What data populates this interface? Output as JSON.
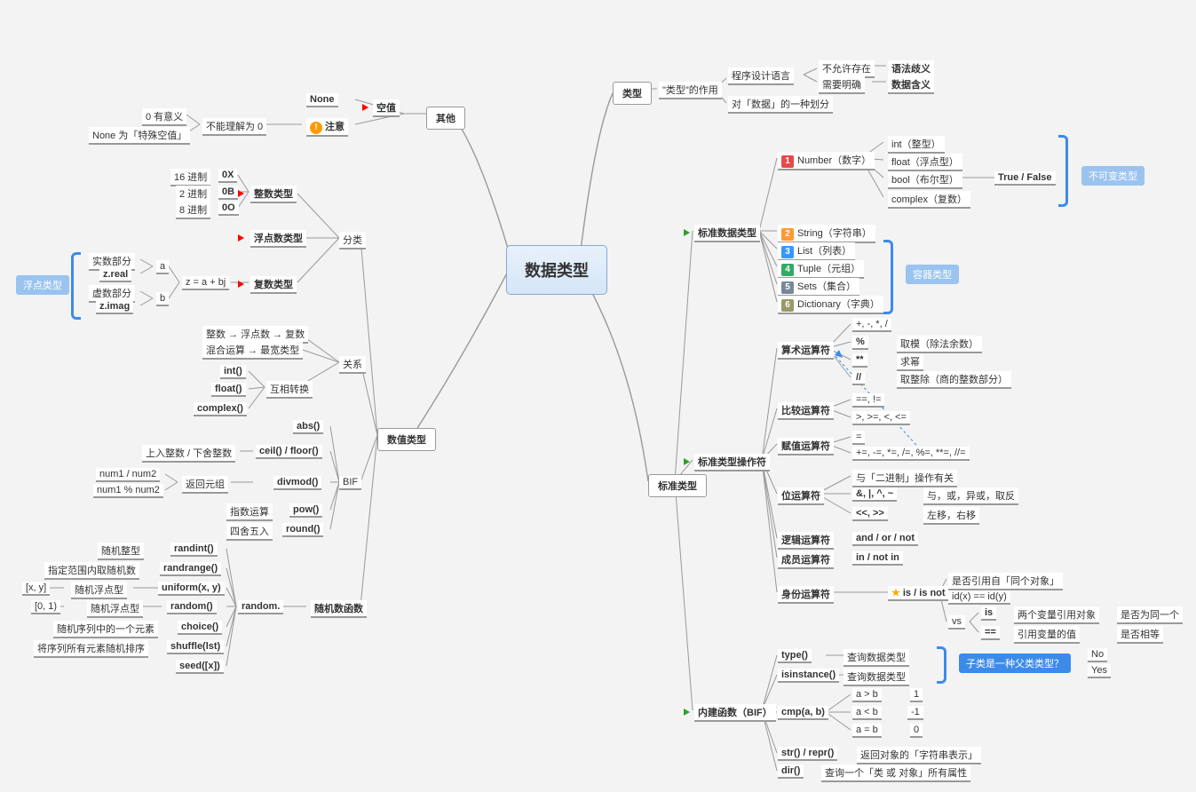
{
  "center": "数据类型",
  "leixing": {
    "title": "类型",
    "role": "\"类型\"的作用",
    "design": "程序设计语言",
    "notallow": "不允许存在",
    "syntax": "语法歧义",
    "need": "需要明确",
    "meaning": "数据含义",
    "classify": "对「数据」的一种划分"
  },
  "biaozhun": {
    "title": "标准类型",
    "stdlabel": "标准数据类型",
    "oplabel": "标准类型操作符",
    "biflabel": "内建函数（BIF）",
    "num": {
      "n": "1",
      "name": "Number（数字）",
      "int": "int（整型）",
      "float": "float（浮点型）",
      "bool": "bool（布尔型）",
      "booltf": "True / False",
      "complex": "complex（复数）"
    },
    "string": {
      "n": "2",
      "name": "String（字符串）"
    },
    "list": {
      "n": "3",
      "name": "List（列表）"
    },
    "tuple": {
      "n": "4",
      "name": "Tuple（元组）"
    },
    "sets": {
      "n": "5",
      "name": "Sets（集合）"
    },
    "dict": {
      "n": "6",
      "name": "Dictionary（字典）"
    },
    "immutable": "不可变类型",
    "container": "容器类型",
    "ops": {
      "arith": {
        "title": "算术运算符",
        "l1": "+, -, *, /",
        "l2": "%",
        "l2d": "取模（除法余数）",
        "l3": "**",
        "l3d": "求幂",
        "l4": "//",
        "l4d": "取整除（商的整数部分）"
      },
      "cmp": {
        "title": "比较运算符",
        "l1": "==, !=",
        "l2": ">, >=, <, <="
      },
      "assign": {
        "title": "赋值运算符",
        "l1": "=",
        "l2": "+=, -=, *=, /=, %=, **=, //="
      },
      "bit": {
        "title": "位运算符",
        "l1": "与「二进制」操作有关",
        "l2": "&, |, ^, ~",
        "l2d": "与，或，异或，取反",
        "l3": "<<, >>",
        "l3d": "左移，右移"
      },
      "logic": {
        "title": "逻辑运算符",
        "val": "and / or / not"
      },
      "member": {
        "title": "成员运算符",
        "val": "in / not in"
      },
      "identity": {
        "title": "身份运算符",
        "val": "is / is not",
        "d1": "是否引用自「同个对象」",
        "d2": "id(x) == id(y)",
        "vs": "vs",
        "is": "is",
        "isdesc": "两个变量引用对象",
        "isask": "是否为同一个",
        "eq": "==",
        "eqdesc": "引用变量的值",
        "eqask": "是否相等"
      }
    },
    "bif": {
      "type": "type()",
      "typed": "查询数据类型",
      "isinst": "isinstance()",
      "isinstd": "查询数据类型",
      "cmp": "cmp(a, b)",
      "c1": "a > b",
      "c1v": "1",
      "c2": "a < b",
      "c2v": "-1",
      "c3": "a = b",
      "c3v": "0",
      "str": "str() / repr()",
      "strd": "返回对象的「字符串表示」",
      "dir": "dir()",
      "dird": "查询一个「类 或 对象」所有属性",
      "callout": "子类是一种父类类型？",
      "no": "No",
      "yes": "Yes"
    }
  },
  "shuzhi": {
    "title": "数值类型",
    "fenlei": "分类",
    "ints": {
      "title": "整数类型",
      "b16": "16 进制",
      "b16v": "0X",
      "b2": "2 进制",
      "b2v": "0B",
      "b8": "8 进制",
      "b8v": "0O"
    },
    "floats": "浮点数类型",
    "complex": {
      "title": "复数类型",
      "eq": "z = a + bj",
      "a": "a",
      "b": "b",
      "real": "实数部分",
      "zreal": "z.real",
      "imag": "虚数部分",
      "zimag": "z.imag",
      "floattype": "浮点类型"
    },
    "guanxi": {
      "title": "关系",
      "l1": "整数 → 浮点数 → 复数",
      "l2": "混合运算 → 最宽类型",
      "convert": "互相转换",
      "int": "int()",
      "float": "float()",
      "complex": "complex()"
    },
    "bif": {
      "title": "BIF",
      "abs": "abs()",
      "ceil": "ceil() / floor()",
      "ceild": "上入整数 / 下舍整数",
      "divmod": "divmod()",
      "divmodd": "返回元组",
      "dn1": "num1 / num2",
      "dn2": "num1 % num2",
      "pow": "pow()",
      "powd": "指数运算",
      "round": "round()",
      "roundd": "四舍五入"
    },
    "random": {
      "title": "随机数函数",
      "mod": "random.",
      "randint": "randint()",
      "randintd": "随机整型",
      "randrange": "randrange()",
      "randranged": "指定范围内取随机数",
      "uniform": "uniform(x, y)",
      "uniformd": "随机浮点型",
      "uniformr": "[x, y]",
      "random": "random()",
      "randomd": "随机浮点型",
      "randomr": "[0, 1)",
      "choice": "choice()",
      "choiced": "随机序列中的一个元素",
      "shuffle": "shuffle(lst)",
      "shuffled": "将序列所有元素随机排序",
      "seed": "seed([x])"
    }
  },
  "qita": {
    "title": "其他",
    "none": "None",
    "attention": "注意",
    "empty": "空值",
    "understand": "不能理解为 0",
    "zero": "0 有意义",
    "special": "None 为「特殊空值」"
  }
}
